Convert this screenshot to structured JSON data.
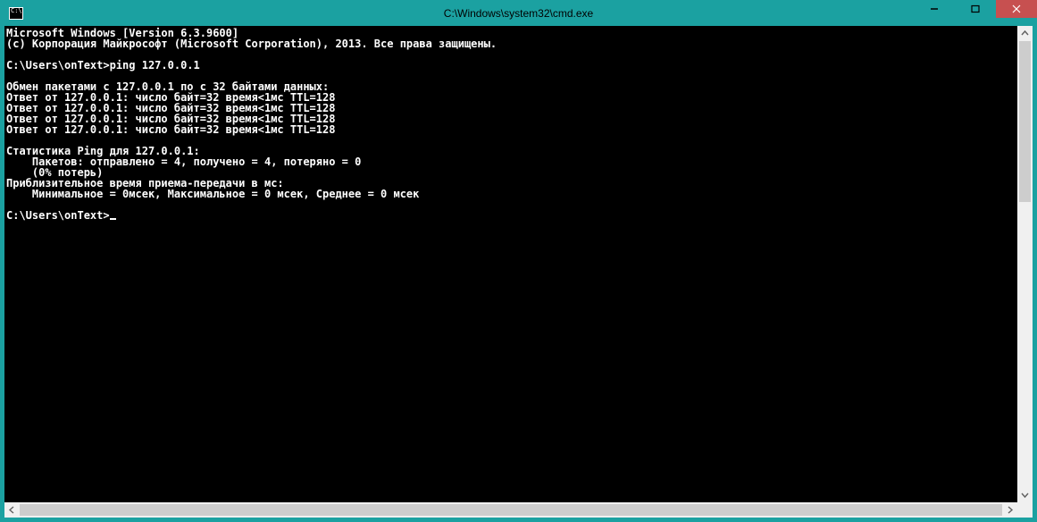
{
  "window": {
    "title": "C:\\Windows\\system32\\cmd.exe"
  },
  "terminal": {
    "lines": [
      "Microsoft Windows [Version 6.3.9600]",
      "(c) Корпорация Майкрософт (Microsoft Corporation), 2013. Все права защищены.",
      "",
      "C:\\Users\\onText>ping 127.0.0.1",
      "",
      "Обмен пакетами с 127.0.0.1 по с 32 байтами данных:",
      "Ответ от 127.0.0.1: число байт=32 время<1мс TTL=128",
      "Ответ от 127.0.0.1: число байт=32 время<1мс TTL=128",
      "Ответ от 127.0.0.1: число байт=32 время<1мс TTL=128",
      "Ответ от 127.0.0.1: число байт=32 время<1мс TTL=128",
      "",
      "Статистика Ping для 127.0.0.1:",
      "    Пакетов: отправлено = 4, получено = 4, потеряно = 0",
      "    (0% потерь)",
      "Приблизительное время приема-передачи в мс:",
      "    Минимальное = 0мсек, Максимальное = 0 мсек, Среднее = 0 мсек",
      "",
      "C:\\Users\\onText>"
    ]
  },
  "colors": {
    "frame": "#1ba1a1",
    "close": "#c75050",
    "console_bg": "#000000",
    "console_fg": "#ffffff",
    "scrollbar": "#f0f0f0",
    "thumb": "#cdcdcd"
  }
}
